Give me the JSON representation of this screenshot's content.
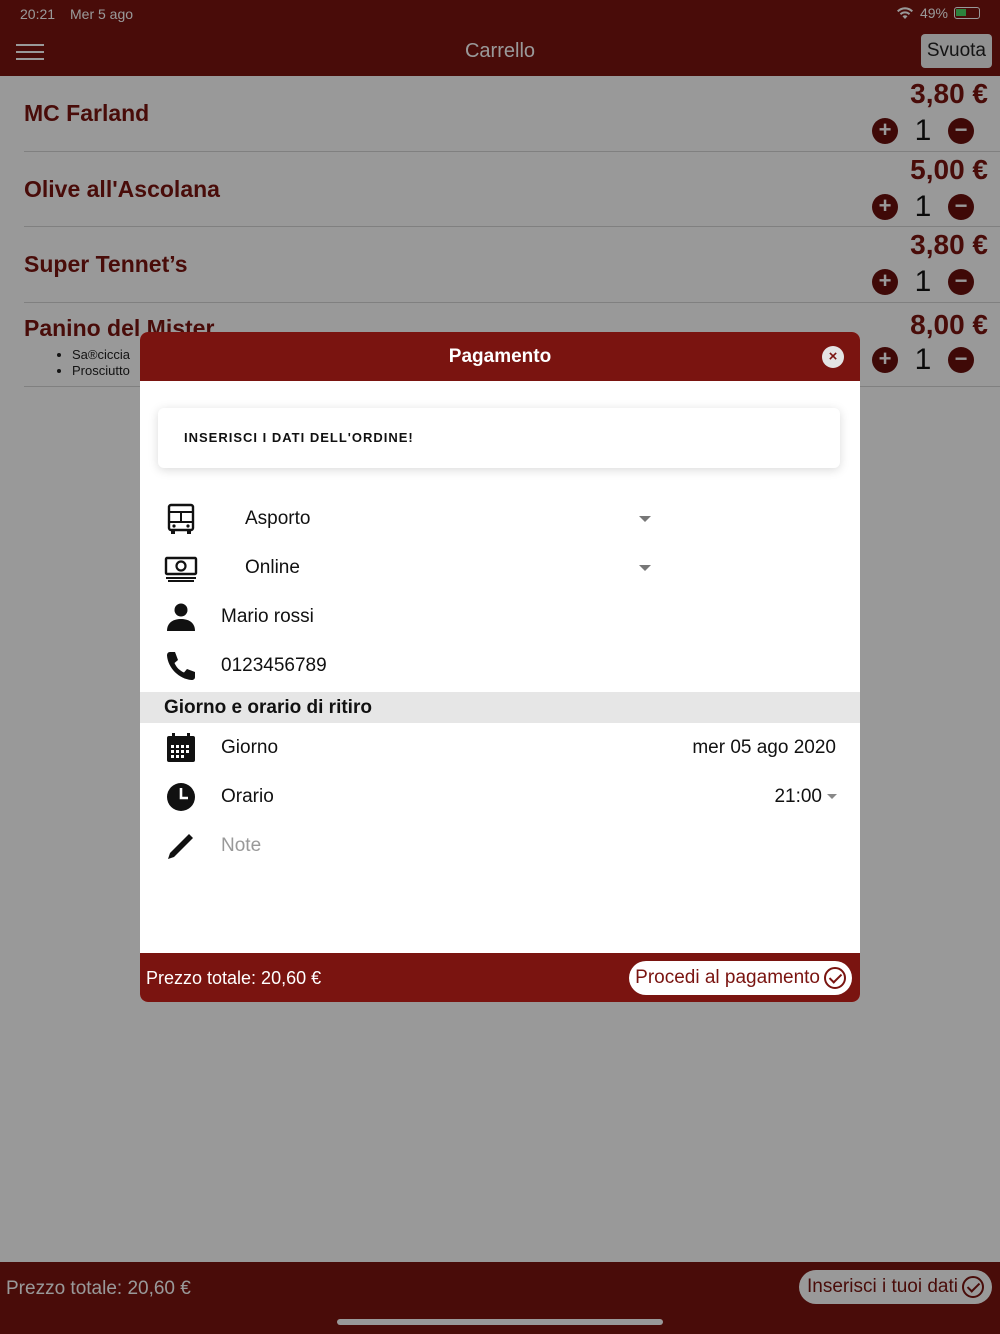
{
  "status_bar": {
    "time": "20:21",
    "date": "Mer 5 ago",
    "battery": "49%",
    "battery_level": 0.49
  },
  "navbar": {
    "title": "Carrello",
    "empty_button": "Svuota"
  },
  "cart": {
    "items": [
      {
        "name": "MC Farland",
        "price": "3,80 €",
        "qty": "1"
      },
      {
        "name": "Olive all'Ascolana",
        "price": "5,00 €",
        "qty": "1"
      },
      {
        "name": "Super Tennet’s",
        "price": "3,80 €",
        "qty": "1"
      },
      {
        "name": "Panino del Mister",
        "price": "8,00 €",
        "qty": "1",
        "extras": [
          "Sa®ciccia",
          "Prosciutto"
        ]
      }
    ],
    "plus_symbol": "+",
    "minus_symbol": "−"
  },
  "bottom_bar": {
    "total": "Prezzo totale: 20,60 €",
    "cta": "Inserisci i tuoi dati"
  },
  "modal": {
    "title": "Pagamento",
    "close_symbol": "×",
    "notice": "INSERISCI I DATI DELL'ORDINE!",
    "fields": {
      "delivery_type": "Asporto",
      "payment_method": "Online",
      "name": "Mario rossi",
      "phone": "0123456789"
    },
    "section_title": "Giorno e orario di ritiro",
    "day": {
      "label": "Giorno",
      "value": "mer 05 ago 2020"
    },
    "time": {
      "label": "Orario",
      "value": "21:00"
    },
    "notes_placeholder": "Note",
    "footer": {
      "total": "Prezzo totale: 20,60 €",
      "pay_button": "Procedi al pagamento"
    }
  },
  "colors": {
    "primary": "#7a1410",
    "overlay": "rgba(0,0,0,0.4)"
  },
  "icons": [
    "menu-icon",
    "bus-icon",
    "cash-icon",
    "person-icon",
    "phone-icon",
    "calendar-icon",
    "clock-icon",
    "pencil-icon",
    "check-circle-icon",
    "close-icon"
  ]
}
